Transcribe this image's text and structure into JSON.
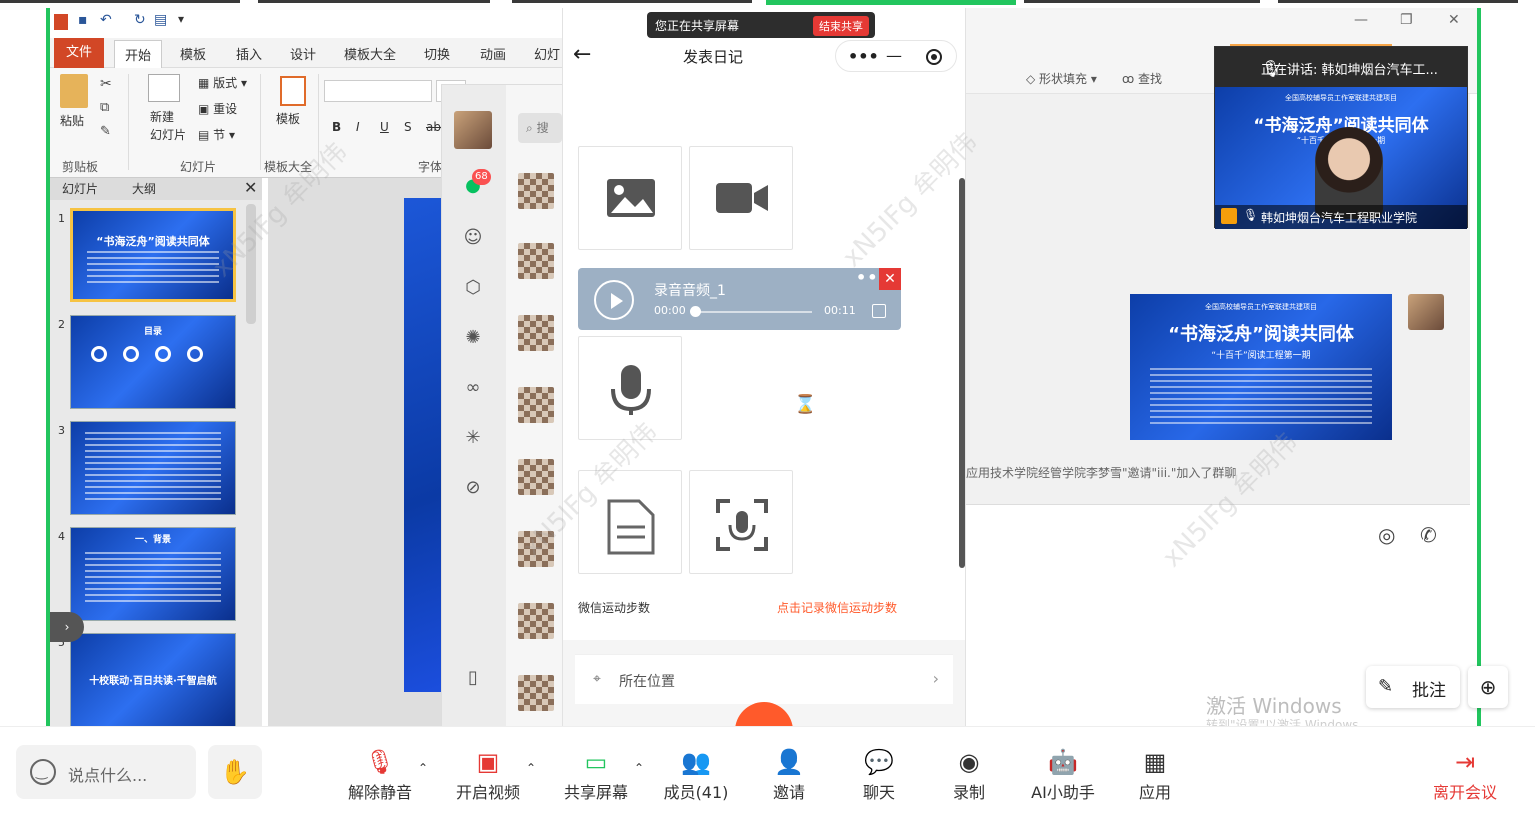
{
  "share_bar": {
    "text": "您正在共享屏幕",
    "end": "结束共享"
  },
  "ppt": {
    "file_tab": "文件",
    "tabs": [
      "开始",
      "模板",
      "插入",
      "设计",
      "模板大全",
      "切换",
      "动画",
      "幻灯"
    ],
    "ribbon": {
      "paste": "粘贴",
      "new_slide": "新建\n幻灯片",
      "layout": "版式",
      "reset": "重设",
      "section": "节",
      "template": "模板",
      "groups": [
        "剪贴板",
        "幻灯片",
        "模板大全",
        "字体"
      ]
    },
    "pane_tabs": [
      "幻灯片",
      "大纲"
    ],
    "slides": [
      {
        "num": "1",
        "title": "“书海泛舟”阅读共同体"
      },
      {
        "num": "2",
        "title": "目录"
      },
      {
        "num": "3",
        "title": ""
      },
      {
        "num": "4",
        "title": "一、背景"
      },
      {
        "num": "5",
        "title": "十校联动·百日共读·千智启航"
      }
    ]
  },
  "wechat": {
    "badge": "68",
    "search": "搜"
  },
  "diary": {
    "title": "发表日记",
    "audio": {
      "name": "录音音频_1",
      "current": "00:00",
      "duration": "00:11",
      "progress": 0.0
    },
    "steps_label": "微信运动步数",
    "steps_link": "点击记录微信运动步数",
    "location": "所在位置"
  },
  "right_panel": {
    "fill_tool": "形状填充",
    "find_tool": "查找",
    "system_message": "应用技术学院经管学院李梦雪\"邀请\"iii.\"加入了群聊",
    "watermark_line1": "激活 Windows",
    "watermark_line2": "转到\"设置\"以激活 Windows",
    "annotate": "批注",
    "shared_title": "“书海泛舟”阅读共同体",
    "shared_sub": "“十百千”阅读工程第一期",
    "shared_top": "全国高校辅导员工作室联建共建项目"
  },
  "speaker": {
    "label": "正在讲话:",
    "name": "韩如坤烟台汽车工...",
    "bottom_name": "韩如坤烟台汽车工程职业学院",
    "video_top": "全国高校辅导员工作室联建共建项目",
    "video_title": "“书海泛舟”阅读共同体",
    "video_sub": "“十百千”阅读工程第一期"
  },
  "toolbar": {
    "say_placeholder": "说点什么...",
    "buttons": [
      {
        "id": "unmute",
        "label": "解除静音"
      },
      {
        "id": "video",
        "label": "开启视频"
      },
      {
        "id": "share",
        "label": "共享屏幕"
      },
      {
        "id": "members",
        "label": "成员(41)"
      },
      {
        "id": "invite",
        "label": "邀请"
      },
      {
        "id": "chat",
        "label": "聊天"
      },
      {
        "id": "record",
        "label": "录制"
      },
      {
        "id": "ai",
        "label": "AI小助手"
      },
      {
        "id": "apps",
        "label": "应用"
      },
      {
        "id": "leave",
        "label": "离开会议"
      }
    ]
  },
  "colors": {
    "accent_green": "#22c55e",
    "brand_red": "#e53935",
    "ppt_red": "#d24726",
    "diary_orange": "#ff5a2b"
  }
}
